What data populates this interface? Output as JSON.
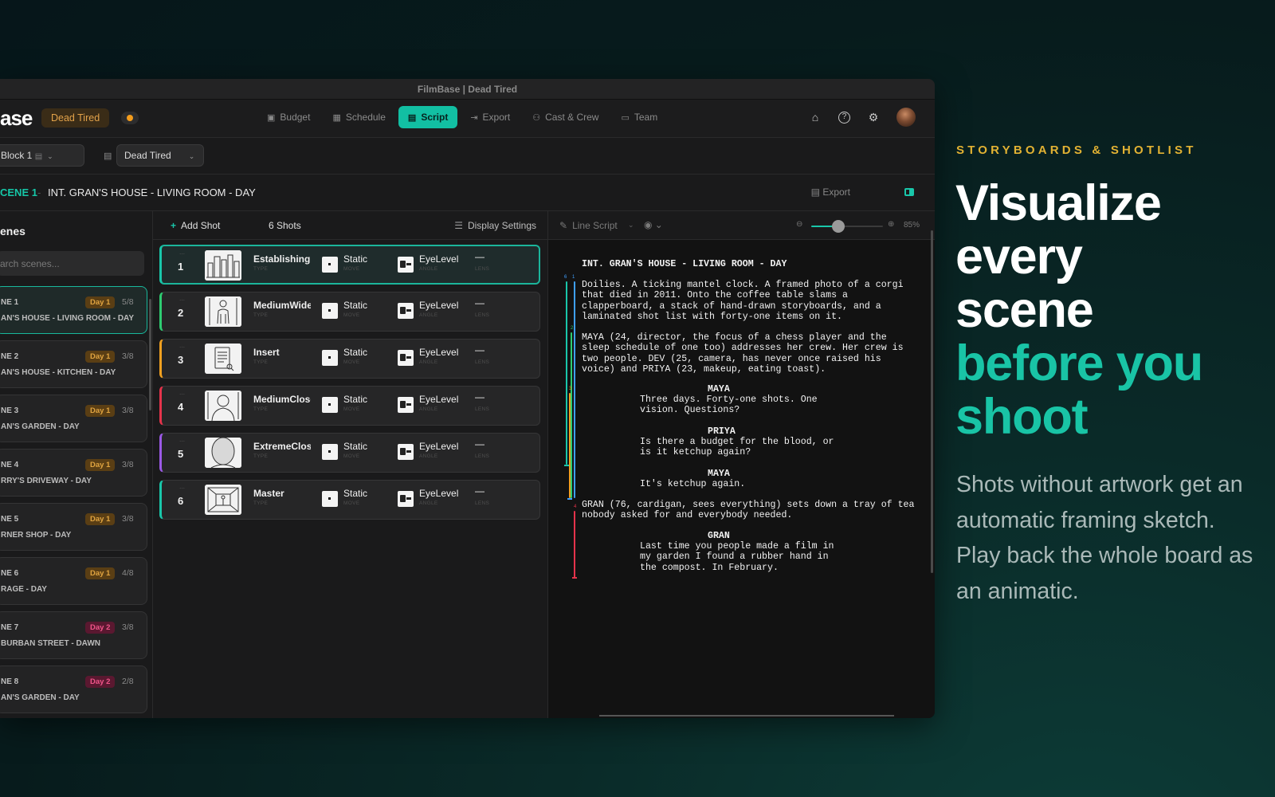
{
  "app": {
    "window_title": "FilmBase | Dead Tired",
    "logo_text": "ase",
    "project_badge": "Dead Tired",
    "status_color": "#f39c1c",
    "accent_color": "#12bfa3"
  },
  "nav": {
    "tabs": [
      {
        "label": "Budget",
        "icon": "dollar-icon"
      },
      {
        "label": "Schedule",
        "icon": "calendar-icon"
      },
      {
        "label": "Script",
        "icon": "script-icon",
        "active": true
      },
      {
        "label": "Export",
        "icon": "export-icon"
      },
      {
        "label": "Cast & Crew",
        "icon": "people-icon"
      },
      {
        "label": "Team",
        "icon": "chat-icon"
      }
    ],
    "right_icons": [
      "home-icon",
      "help-icon",
      "gear-icon",
      "avatar"
    ]
  },
  "toolbar": {
    "block_select": "Block 1",
    "script_select": "Dead Tired"
  },
  "scene_header": {
    "number": "CENE 1",
    "separator": "-",
    "title": "INT. GRAN'S HOUSE - LIVING ROOM - DAY",
    "export_label": "Export"
  },
  "scenes_panel": {
    "title": "enes",
    "search_placeholder": "arch scenes...",
    "scenes": [
      {
        "num": "NE 1",
        "title": "AN'S HOUSE - LIVING ROOM - DAY",
        "day": "Day 1",
        "pages": "5/8",
        "active": true
      },
      {
        "num": "NE 2",
        "title": "AN'S HOUSE - KITCHEN - DAY",
        "day": "Day 1",
        "pages": "3/8"
      },
      {
        "num": "NE 3",
        "title": "AN'S GARDEN - DAY",
        "day": "Day 1",
        "pages": "3/8"
      },
      {
        "num": "NE 4",
        "title": "RRY'S DRIVEWAY - DAY",
        "day": "Day 1",
        "pages": "3/8"
      },
      {
        "num": "NE 5",
        "title": "RNER SHOP - DAY",
        "day": "Day 1",
        "pages": "3/8"
      },
      {
        "num": "NE 6",
        "title": "RAGE - DAY",
        "day": "Day 1",
        "pages": "4/8"
      },
      {
        "num": "NE 7",
        "title": "BURBAN STREET - DAWN",
        "day": "Day 2",
        "pages": "3/8"
      },
      {
        "num": "NE 8",
        "title": "AN'S GARDEN - DAY",
        "day": "Day 2",
        "pages": "2/8"
      }
    ]
  },
  "shots_panel": {
    "add_shot_label": "Add Shot",
    "shot_count": "6 Shots",
    "display_settings": "Display Settings",
    "sub_labels": {
      "type": "TYPE",
      "move": "MOVE",
      "angle": "ANGLE",
      "lens": "LENS"
    },
    "shots": [
      {
        "num": "1",
        "type": "Establishing",
        "move": "Static",
        "angle": "EyeLevel",
        "lens": "—",
        "color": "#19c7aa",
        "thumb": "establishing",
        "active": true
      },
      {
        "num": "2",
        "type": "MediumWide",
        "move": "Static",
        "angle": "EyeLevel",
        "lens": "—",
        "color": "#2ecc71",
        "thumb": "figure"
      },
      {
        "num": "3",
        "type": "Insert",
        "move": "Static",
        "angle": "EyeLevel",
        "lens": "—",
        "color": "#f0a020",
        "thumb": "insert"
      },
      {
        "num": "4",
        "type": "MediumClose",
        "move": "Static",
        "angle": "EyeLevel",
        "lens": "—",
        "color": "#e5334b",
        "thumb": "bust"
      },
      {
        "num": "5",
        "type": "ExtremeClose",
        "move": "Static",
        "angle": "EyeLevel",
        "lens": "—",
        "color": "#9b59e6",
        "thumb": "head"
      },
      {
        "num": "6",
        "type": "Master",
        "move": "Static",
        "angle": "EyeLevel",
        "lens": "—",
        "color": "#19c7aa",
        "thumb": "room"
      }
    ]
  },
  "script_panel": {
    "line_script_label": "Line Script",
    "zoom_value": "85%",
    "zoom_level": 0.38,
    "heading": "INT. GRAN'S HOUSE - LIVING ROOM - DAY",
    "action1": "Doilies. A ticking mantel clock. A framed photo of a corgi\nthat died in 2011. Onto the coffee table slams a\nclapperboard, a stack of hand-drawn storyboards, and a\nlaminated shot list with forty-one items on it.",
    "action2": "MAYA (24, director, the focus of a chess player and the\nsleep schedule of one too) addresses her crew. Her crew is\ntwo people. DEV (25, camera, has never once raised his\nvoice) and PRIYA (23, makeup, eating toast).",
    "char1": "MAYA",
    "dial1": "Three days. Forty-one shots. One\nvision. Questions?",
    "char2": "PRIYA",
    "dial2": "Is there a budget for the blood, or\nis it ketchup again?",
    "char3": "MAYA",
    "dial3": "It's ketchup again.",
    "action3": "GRAN (76, cardigan, sees everything) sets down a tray of tea\nnobody asked for and everybody needed.",
    "char4": "GRAN",
    "dial4": "Last time you people made a film in\nmy garden I found a rubber hand in\nthe compost. In February.",
    "line_labels": [
      "6",
      "1",
      "2",
      "3",
      "4"
    ]
  },
  "marketing": {
    "eyebrow": "STORYBOARDS & SHOTLIST",
    "headline_white": "Visualize every scene",
    "headline_accent": "before you shoot",
    "body": "Shots without artwork get an automatic framing sketch. Play back the whole board as an animatic."
  }
}
